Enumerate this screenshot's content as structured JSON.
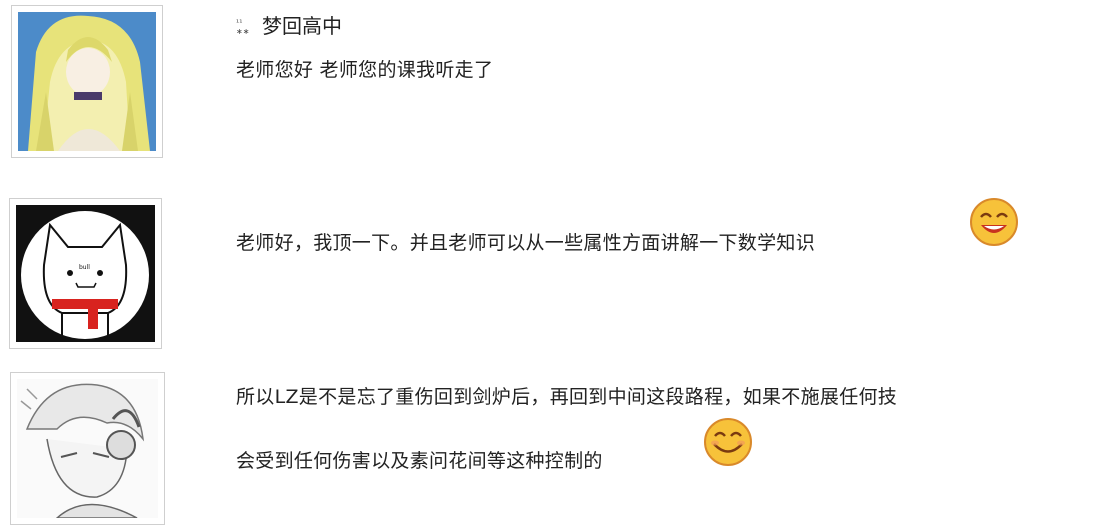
{
  "comments": [
    {
      "avatar": "anime-girl-blonde-avatar",
      "user_tag": "¹¹ ∗∗",
      "username": "梦回高中",
      "text": "老师您好 老师您的课我听走了"
    },
    {
      "avatar": "white-cat-red-scarf-avatar",
      "avatar_tag": "bull",
      "text": "老师好，我顶一下。并且老师可以从一些属性方面讲解一下数学知识",
      "emoji": "laughing-face-icon"
    },
    {
      "avatar": "sketch-boy-headphones-avatar",
      "text_line1": "所以LZ是不是忘了重伤回到剑炉后，再回到中间这段路程，如果不施展任何技",
      "text_line2": "会受到任何伤害以及素问花间等这种控制的",
      "emoji": "grinning-face-icon"
    }
  ],
  "colors": {
    "emoji_yellow": "#f7c23a",
    "emoji_outline": "#d9892a",
    "scarf_red": "#d8231f"
  }
}
